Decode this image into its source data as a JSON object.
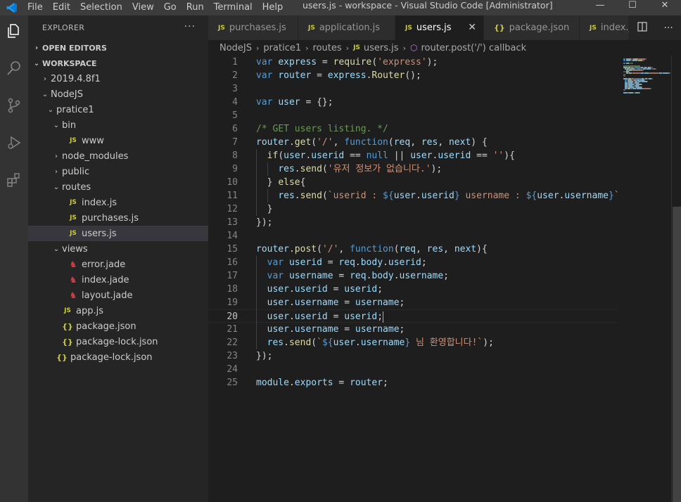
{
  "titlebar": {
    "menu": [
      "File",
      "Edit",
      "Selection",
      "View",
      "Go",
      "Run",
      "Terminal",
      "Help"
    ],
    "title": "users.js - workspace - Visual Studio Code [Administrator]",
    "minimize": "—",
    "maximize": "☐",
    "close": "✕"
  },
  "activity": [
    "explorer-icon",
    "search-icon",
    "source-control-icon",
    "run-debug-icon",
    "extensions-icon"
  ],
  "sidebar": {
    "title": "EXPLORER",
    "more": "···",
    "open_editors": "OPEN EDITORS",
    "workspace": "WORKSPACE",
    "tree": [
      {
        "label": "2019.4.8f1",
        "chev": "›",
        "icon": "",
        "indent": 0
      },
      {
        "label": "NodeJS",
        "chev": "⌄",
        "icon": "",
        "indent": 0
      },
      {
        "label": "pratice1",
        "chev": "⌄",
        "icon": "",
        "indent": 1
      },
      {
        "label": "bin",
        "chev": "⌄",
        "icon": "",
        "indent": 2
      },
      {
        "label": "www",
        "chev": "",
        "icon": "JS",
        "indent": 3
      },
      {
        "label": "node_modules",
        "chev": "›",
        "icon": "",
        "indent": 2
      },
      {
        "label": "public",
        "chev": "›",
        "icon": "",
        "indent": 2
      },
      {
        "label": "routes",
        "chev": "⌄",
        "icon": "",
        "indent": 2
      },
      {
        "label": "index.js",
        "chev": "",
        "icon": "JS",
        "indent": 3
      },
      {
        "label": "purchases.js",
        "chev": "",
        "icon": "JS",
        "indent": 3
      },
      {
        "label": "users.js",
        "chev": "",
        "icon": "JS",
        "indent": 3,
        "active": true
      },
      {
        "label": "views",
        "chev": "⌄",
        "icon": "",
        "indent": 2
      },
      {
        "label": "error.jade",
        "chev": "",
        "icon": "jade",
        "indent": 3
      },
      {
        "label": "index.jade",
        "chev": "",
        "icon": "jade",
        "indent": 3
      },
      {
        "label": "layout.jade",
        "chev": "",
        "icon": "jade",
        "indent": 3
      },
      {
        "label": "app.js",
        "chev": "",
        "icon": "JS",
        "indent": 2
      },
      {
        "label": "package.json",
        "chev": "",
        "icon": "{}",
        "indent": 2
      },
      {
        "label": "package-lock.json",
        "chev": "",
        "icon": "{}",
        "indent": 2
      },
      {
        "label": "package-lock.json",
        "chev": "",
        "icon": "{}",
        "indent": 1
      }
    ]
  },
  "tabs": [
    {
      "label": "purchases.js",
      "icon": "JS",
      "active": false
    },
    {
      "label": "application.js",
      "icon": "JS",
      "active": false
    },
    {
      "label": "users.js",
      "icon": "JS",
      "active": true
    },
    {
      "label": "package.json",
      "icon": "{}",
      "active": false
    },
    {
      "label": "index.js",
      "icon": "JS",
      "active": false
    }
  ],
  "tab_actions": {
    "split": "split-editor-icon",
    "more": "···"
  },
  "breadcrumb": [
    "NodeJS",
    "pratice1",
    "routes",
    "users.js",
    "router.post('/') callback"
  ],
  "editor": {
    "current_line": 20,
    "lines": [
      [
        [
          "kw",
          "var"
        ],
        [
          "pl",
          " "
        ],
        [
          "var",
          "express"
        ],
        [
          "pl",
          " = "
        ],
        [
          "fn",
          "require"
        ],
        [
          "pl",
          "("
        ],
        [
          "str",
          "'express'"
        ],
        [
          "pl",
          ");"
        ]
      ],
      [
        [
          "kw",
          "var"
        ],
        [
          "pl",
          " "
        ],
        [
          "var",
          "router"
        ],
        [
          "pl",
          " = "
        ],
        [
          "var",
          "express"
        ],
        [
          "pl",
          "."
        ],
        [
          "fn",
          "Router"
        ],
        [
          "pl",
          "();"
        ]
      ],
      [],
      [
        [
          "kw",
          "var"
        ],
        [
          "pl",
          " "
        ],
        [
          "var",
          "user"
        ],
        [
          "pl",
          " = {};"
        ]
      ],
      [],
      [
        [
          "cm",
          "/* GET users listing. */"
        ]
      ],
      [
        [
          "var",
          "router"
        ],
        [
          "pl",
          "."
        ],
        [
          "fn",
          "get"
        ],
        [
          "pl",
          "("
        ],
        [
          "str",
          "'/'"
        ],
        [
          "pl",
          ", "
        ],
        [
          "kw",
          "function"
        ],
        [
          "pl",
          "("
        ],
        [
          "var",
          "req"
        ],
        [
          "pl",
          ", "
        ],
        [
          "var",
          "res"
        ],
        [
          "pl",
          ", "
        ],
        [
          "var",
          "next"
        ],
        [
          "pl",
          ") {"
        ]
      ],
      [
        [
          "pl",
          "  "
        ],
        [
          "fn",
          "if"
        ],
        [
          "pl",
          "("
        ],
        [
          "var",
          "user"
        ],
        [
          "pl",
          "."
        ],
        [
          "var",
          "userid"
        ],
        [
          "pl",
          " == "
        ],
        [
          "kw",
          "null"
        ],
        [
          "pl",
          " || "
        ],
        [
          "var",
          "user"
        ],
        [
          "pl",
          "."
        ],
        [
          "var",
          "userid"
        ],
        [
          "pl",
          " == "
        ],
        [
          "str",
          "''"
        ],
        [
          "pl",
          "){"
        ]
      ],
      [
        [
          "pl",
          "    "
        ],
        [
          "var",
          "res"
        ],
        [
          "pl",
          "."
        ],
        [
          "fn",
          "send"
        ],
        [
          "pl",
          "("
        ],
        [
          "str",
          "'유저 정보가 없습니다.'"
        ],
        [
          "pl",
          ");"
        ]
      ],
      [
        [
          "pl",
          "  } "
        ],
        [
          "fn",
          "else"
        ],
        [
          "pl",
          "{"
        ]
      ],
      [
        [
          "pl",
          "    "
        ],
        [
          "var",
          "res"
        ],
        [
          "pl",
          "."
        ],
        [
          "fn",
          "send"
        ],
        [
          "pl",
          "("
        ],
        [
          "str",
          "`userid : "
        ],
        [
          "kw",
          "${"
        ],
        [
          "var",
          "user"
        ],
        [
          "pl",
          "."
        ],
        [
          "var",
          "userid"
        ],
        [
          "kw",
          "}"
        ],
        [
          "str",
          " username : "
        ],
        [
          "kw",
          "${"
        ],
        [
          "var",
          "user"
        ],
        [
          "pl",
          "."
        ],
        [
          "var",
          "username"
        ],
        [
          "kw",
          "}"
        ],
        [
          "str",
          "`"
        ],
        [
          "pl",
          ")"
        ]
      ],
      [
        [
          "pl",
          "  }"
        ]
      ],
      [
        [
          "pl",
          "});"
        ]
      ],
      [],
      [
        [
          "var",
          "router"
        ],
        [
          "pl",
          "."
        ],
        [
          "fn",
          "post"
        ],
        [
          "pl",
          "("
        ],
        [
          "str",
          "'/'"
        ],
        [
          "pl",
          ", "
        ],
        [
          "kw",
          "function"
        ],
        [
          "pl",
          "("
        ],
        [
          "var",
          "req"
        ],
        [
          "pl",
          ", "
        ],
        [
          "var",
          "res"
        ],
        [
          "pl",
          ", "
        ],
        [
          "var",
          "next"
        ],
        [
          "pl",
          "){"
        ]
      ],
      [
        [
          "pl",
          "  "
        ],
        [
          "kw",
          "var"
        ],
        [
          "pl",
          " "
        ],
        [
          "var",
          "userid"
        ],
        [
          "pl",
          " = "
        ],
        [
          "var",
          "req"
        ],
        [
          "pl",
          "."
        ],
        [
          "var",
          "body"
        ],
        [
          "pl",
          "."
        ],
        [
          "var",
          "userid"
        ],
        [
          "pl",
          ";"
        ]
      ],
      [
        [
          "pl",
          "  "
        ],
        [
          "kw",
          "var"
        ],
        [
          "pl",
          " "
        ],
        [
          "var",
          "username"
        ],
        [
          "pl",
          " = "
        ],
        [
          "var",
          "req"
        ],
        [
          "pl",
          "."
        ],
        [
          "var",
          "body"
        ],
        [
          "pl",
          "."
        ],
        [
          "var",
          "username"
        ],
        [
          "pl",
          ";"
        ]
      ],
      [
        [
          "pl",
          "  "
        ],
        [
          "var",
          "user"
        ],
        [
          "pl",
          "."
        ],
        [
          "var",
          "userid"
        ],
        [
          "pl",
          " = "
        ],
        [
          "var",
          "userid"
        ],
        [
          "pl",
          ";"
        ]
      ],
      [
        [
          "pl",
          "  "
        ],
        [
          "var",
          "user"
        ],
        [
          "pl",
          "."
        ],
        [
          "var",
          "username"
        ],
        [
          "pl",
          " = "
        ],
        [
          "var",
          "username"
        ],
        [
          "pl",
          ";"
        ]
      ],
      [
        [
          "pl",
          "  "
        ],
        [
          "var",
          "user"
        ],
        [
          "pl",
          "."
        ],
        [
          "var",
          "userid"
        ],
        [
          "pl",
          " = "
        ],
        [
          "var",
          "userid"
        ],
        [
          "pl",
          ";"
        ]
      ],
      [
        [
          "pl",
          "  "
        ],
        [
          "var",
          "user"
        ],
        [
          "pl",
          "."
        ],
        [
          "var",
          "username"
        ],
        [
          "pl",
          " = "
        ],
        [
          "var",
          "username"
        ],
        [
          "pl",
          ";"
        ]
      ],
      [
        [
          "pl",
          "  "
        ],
        [
          "var",
          "res"
        ],
        [
          "pl",
          "."
        ],
        [
          "fn",
          "send"
        ],
        [
          "pl",
          "("
        ],
        [
          "str",
          "`"
        ],
        [
          "kw",
          "${"
        ],
        [
          "var",
          "user"
        ],
        [
          "pl",
          "."
        ],
        [
          "var",
          "username"
        ],
        [
          "kw",
          "}"
        ],
        [
          "str",
          " 님 환영합니다!`"
        ],
        [
          "pl",
          ");"
        ]
      ],
      [
        [
          "pl",
          "});"
        ]
      ],
      [],
      [
        [
          "var",
          "module"
        ],
        [
          "pl",
          "."
        ],
        [
          "var",
          "exports"
        ],
        [
          "pl",
          " = "
        ],
        [
          "var",
          "router"
        ],
        [
          "pl",
          ";"
        ]
      ]
    ]
  }
}
